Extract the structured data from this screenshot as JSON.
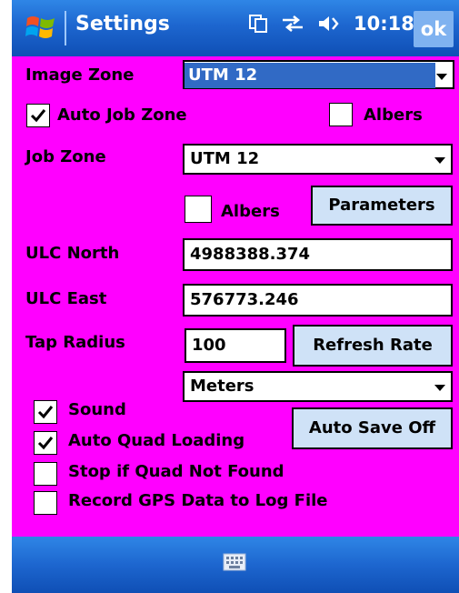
{
  "titlebar": {
    "title": "Settings",
    "clock": "10:18",
    "ok_label": "ok",
    "icons": [
      "windows-flag-icon",
      "sync-icon",
      "connectivity-icon",
      "volume-icon"
    ]
  },
  "image_zone": {
    "label": "Image Zone",
    "value": "UTM 12"
  },
  "auto_job_zone": {
    "label": "Auto Job Zone",
    "checked": true
  },
  "albers_top": {
    "label": "Albers",
    "checked": false
  },
  "job_zone": {
    "label": "Job Zone",
    "value": "UTM 12"
  },
  "albers_mid": {
    "label": "Albers",
    "checked": false
  },
  "parameters_button": "Parameters",
  "ulc_north": {
    "label": "ULC North",
    "value": "4988388.374"
  },
  "ulc_east": {
    "label": "ULC East",
    "value": "576773.246"
  },
  "tap_radius": {
    "label": "Tap Radius",
    "value": "100"
  },
  "refresh_rate_button": "Refresh Rate",
  "units": {
    "value": "Meters"
  },
  "auto_save_button": "Auto Save Off",
  "options": [
    {
      "label": "Sound",
      "checked": true
    },
    {
      "label": "Auto Quad Loading",
      "checked": true
    },
    {
      "label": "Stop if Quad Not Found",
      "checked": false
    },
    {
      "label": "Record GPS Data to Log File",
      "checked": false
    }
  ],
  "colors": {
    "background": "#ff00ff",
    "bar_blue": "#1d66cf",
    "button_bg": "#cfe2f7",
    "selection_blue": "#316ac5"
  }
}
